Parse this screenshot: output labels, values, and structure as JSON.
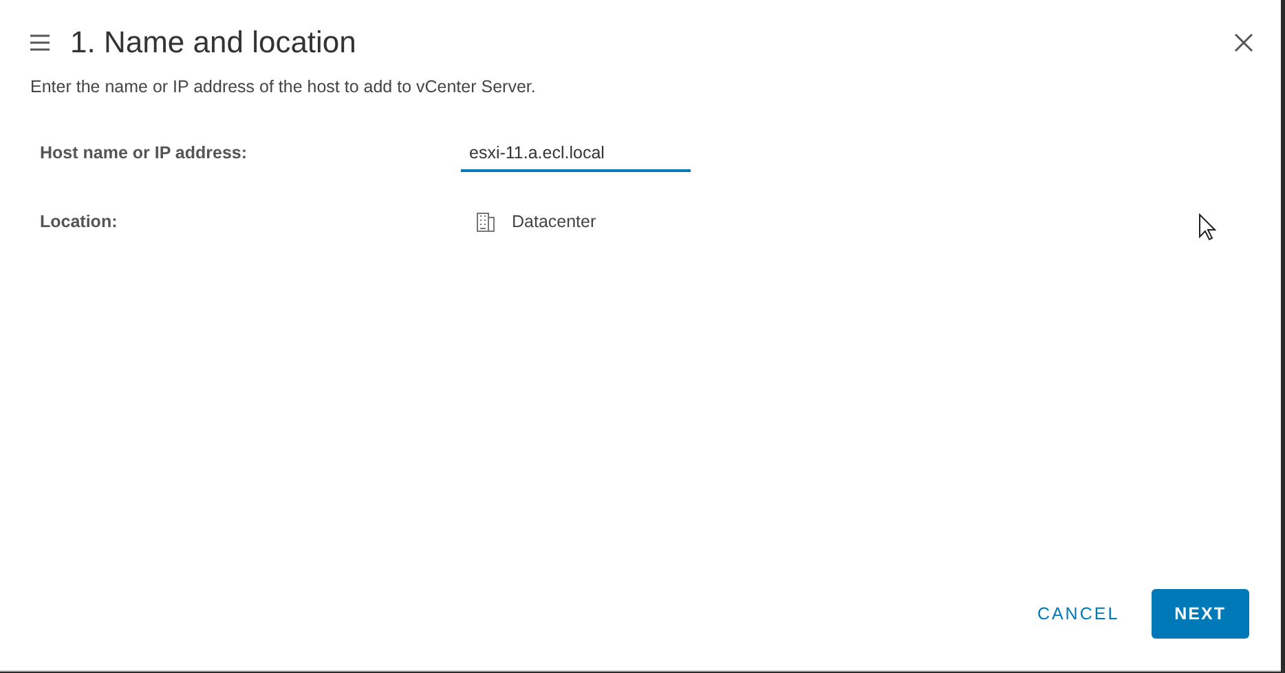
{
  "dialog": {
    "title": "1. Name and location",
    "subtitle": "Enter the name or IP address of the host to add to vCenter Server."
  },
  "fields": [
    {
      "kind": "input",
      "label": "Host name or IP address:",
      "value": "esxi-11.a.ecl.local"
    },
    {
      "kind": "location",
      "label": "Location:",
      "value": "Datacenter"
    }
  ],
  "buttons": [
    {
      "kind": "flat",
      "label": "CANCEL"
    },
    {
      "kind": "primary",
      "label": "NEXT"
    }
  ]
}
